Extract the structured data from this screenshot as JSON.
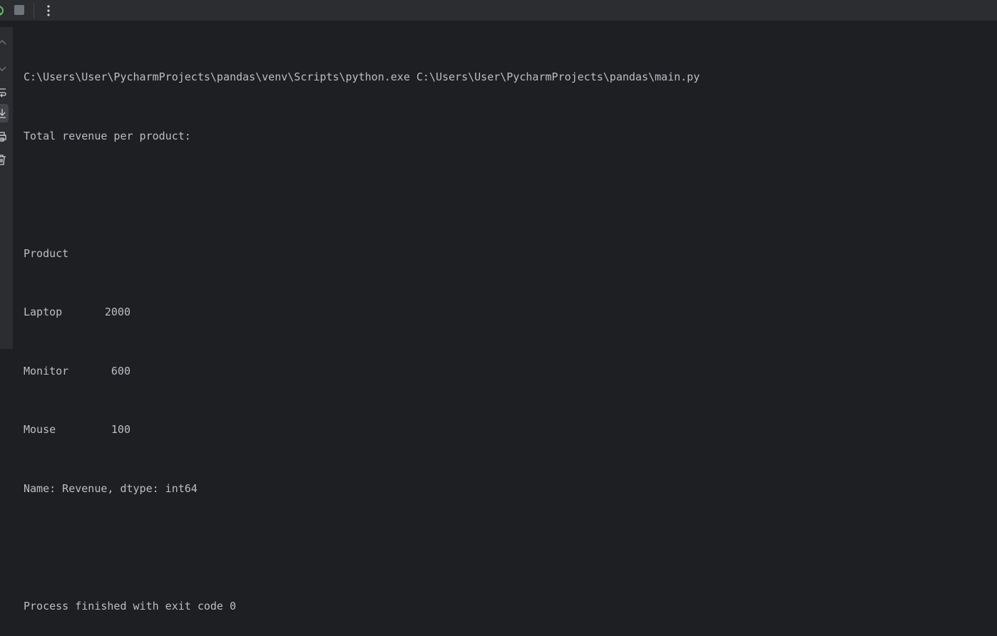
{
  "toolbar": {
    "rerun_icon": "rerun-icon",
    "stop_icon": "stop-icon",
    "more_icon": "more-vertical-icon"
  },
  "left_rail": {
    "icons": [
      "scroll-up-icon",
      "scroll-down-icon",
      "soft-wrap-icon",
      "scroll-to-end-icon",
      "print-icon",
      "trash-icon"
    ]
  },
  "console": {
    "command": "C:\\Users\\User\\PycharmProjects\\pandas\\venv\\Scripts\\python.exe C:\\Users\\User\\PycharmProjects\\pandas\\main.py",
    "heading": "Total revenue per product:",
    "index_name": "Product",
    "rows": [
      {
        "name": "Laptop",
        "value": "2000"
      },
      {
        "name": "Monitor",
        "value": "600"
      },
      {
        "name": "Mouse",
        "value": "100"
      }
    ],
    "series_info": "Name: Revenue, dtype: int64",
    "exit_message": "Process finished with exit code 0"
  },
  "colors": {
    "background": "#1e1f22",
    "panel": "#2b2d30",
    "text": "#bcbec4",
    "rerun_green": "#5fb865"
  }
}
